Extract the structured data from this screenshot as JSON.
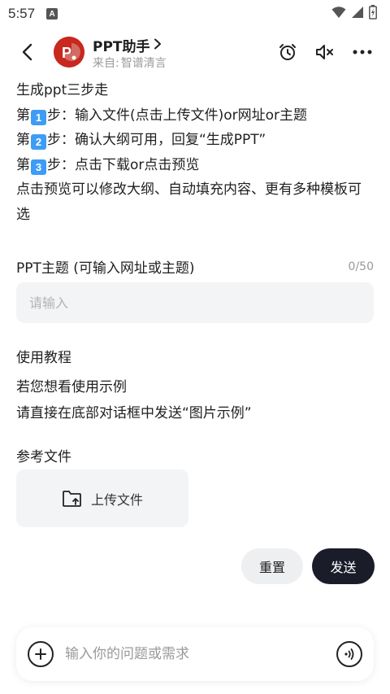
{
  "status_bar": {
    "time": "5:57",
    "a_icon_label": "A"
  },
  "header": {
    "title": "PPT助手",
    "chevron": "›",
    "source_prefix": "来自:",
    "source_name": "智谱清言",
    "avatar_letter": "P",
    "brand_color": "#c8281e"
  },
  "intro": {
    "heading": "生成ppt三步走",
    "steps": [
      {
        "prefix": "第",
        "num": "1",
        "text": "步：输入文件(点击上传文件)or网址or主题"
      },
      {
        "prefix": "第",
        "num": "2",
        "text": "步：确认大纲可用，回复“生成PPT”"
      },
      {
        "prefix": "第",
        "num": "3",
        "text": "步：点击下载or点击预览"
      }
    ],
    "note": "点击预览可以修改大纲、自动填充内容、更有多种模板可选"
  },
  "form": {
    "topic_label": "PPT主题 (可输入网址或主题)",
    "topic_count": "0/50",
    "topic_placeholder": "请输入"
  },
  "tutorial": {
    "heading": "使用教程",
    "line1": "若您想看使用示例",
    "line2": "请直接在底部对话框中发送“图片示例”"
  },
  "reference": {
    "label": "参考文件",
    "upload_label": "上传文件"
  },
  "actions": {
    "reset_label": "重置",
    "send_label": "发送"
  },
  "chat": {
    "placeholder": "输入你的问题或需求"
  },
  "colors": {
    "accent_blue": "#3d9df5",
    "send_bg": "#1a1d29",
    "field_bg": "#f3f4f6"
  }
}
